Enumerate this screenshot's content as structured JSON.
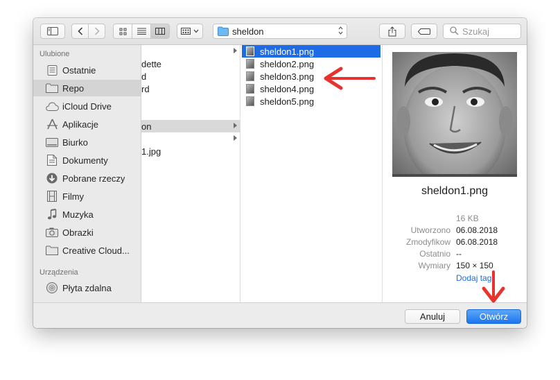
{
  "toolbar": {
    "location": "sheldon",
    "search_placeholder": "Szukaj"
  },
  "sidebar": {
    "favorites_header": "Ulubione",
    "devices_header": "Urządzenia",
    "favorites": [
      {
        "label": "Ostatnie",
        "icon": "recents-icon"
      },
      {
        "label": "Repo",
        "icon": "folder-icon",
        "selected": true
      },
      {
        "label": "iCloud Drive",
        "icon": "cloud-icon"
      },
      {
        "label": "Aplikacje",
        "icon": "applications-icon"
      },
      {
        "label": "Biurko",
        "icon": "desktop-icon"
      },
      {
        "label": "Dokumenty",
        "icon": "documents-icon"
      },
      {
        "label": "Pobrane rzeczy",
        "icon": "downloads-icon"
      },
      {
        "label": "Filmy",
        "icon": "movies-icon"
      },
      {
        "label": "Muzyka",
        "icon": "music-icon"
      },
      {
        "label": "Obrazki",
        "icon": "pictures-icon"
      },
      {
        "label": "Creative Cloud...",
        "icon": "folder-icon"
      }
    ],
    "devices": [
      {
        "label": "Płyta zdalna",
        "icon": "disc-icon"
      }
    ]
  },
  "column1": {
    "rows": [
      {
        "text": "",
        "arrow": true
      },
      {
        "text": "dette",
        "arrow": false
      },
      {
        "text": "d",
        "arrow": false
      },
      {
        "text": "rd",
        "arrow": false
      },
      {
        "text": "",
        "arrow": false
      },
      {
        "text": "",
        "arrow": false
      },
      {
        "text": "on",
        "arrow": true,
        "selected": true
      },
      {
        "text": "",
        "arrow": true
      },
      {
        "text": "1.jpg",
        "arrow": false
      }
    ]
  },
  "column2": {
    "files": [
      {
        "name": "sheldon1.png",
        "selected": true
      },
      {
        "name": "sheldon2.png"
      },
      {
        "name": "sheldon3.png"
      },
      {
        "name": "sheldon4.png"
      },
      {
        "name": "sheldon5.png"
      }
    ]
  },
  "preview": {
    "filename": "sheldon1.png",
    "size": "16 KB",
    "created_label": "Utworzono",
    "created": "06.08.2018",
    "modified_label": "Zmodyfikow",
    "modified": "06.08.2018",
    "last_opened_label": "Ostatnio",
    "last_opened": "--",
    "dimensions_label": "Wymiary",
    "dimensions": "150 × 150",
    "add_tags": "Dodaj tagi"
  },
  "footer": {
    "cancel": "Anuluj",
    "open": "Otwórz"
  },
  "colors": {
    "accent": "#1d6ce5",
    "annotation_arrow": "#e8322e"
  }
}
